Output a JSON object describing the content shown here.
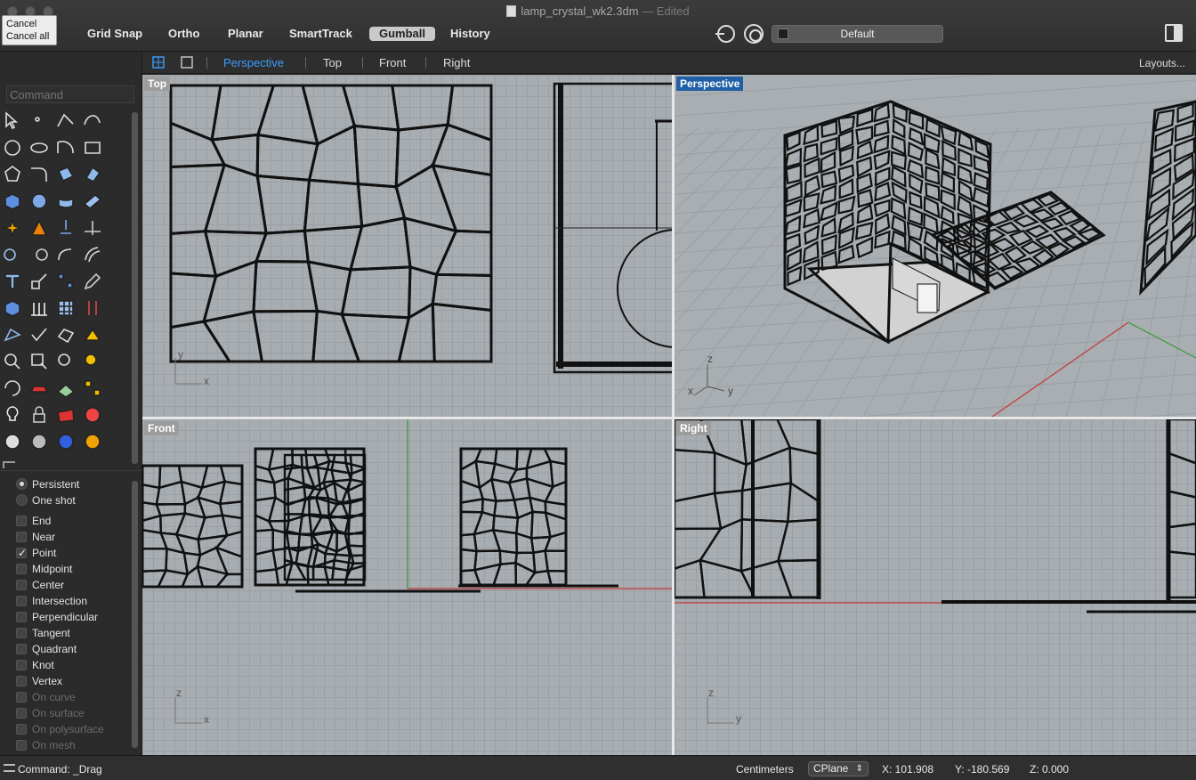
{
  "window": {
    "filename": "lamp_crystal_wk2.3dm",
    "status": "— Edited"
  },
  "cancel": {
    "cancel": "Cancel",
    "cancel_all": "Cancel all"
  },
  "toolbar": {
    "grid_snap": "Grid Snap",
    "ortho": "Ortho",
    "planar": "Planar",
    "smarttrack": "SmartTrack",
    "gumball": "Gumball",
    "history": "History",
    "layer": "Default"
  },
  "tabs": {
    "perspective": "Perspective",
    "top": "Top",
    "front": "Front",
    "right": "Right",
    "layouts": "Layouts..."
  },
  "command": {
    "placeholder": "Command"
  },
  "osnap": {
    "persistent": "Persistent",
    "one_shot": "One shot",
    "end": "End",
    "near": "Near",
    "point": "Point",
    "midpoint": "Midpoint",
    "center": "Center",
    "intersection": "Intersection",
    "perpendicular": "Perpendicular",
    "tangent": "Tangent",
    "quadrant": "Quadrant",
    "knot": "Knot",
    "vertex": "Vertex",
    "on_curve": "On curve",
    "on_surface": "On surface",
    "on_polysurface": "On polysurface",
    "on_mesh": "On mesh"
  },
  "viewports": {
    "top": "Top",
    "perspective": "Perspective",
    "front": "Front",
    "right": "Right"
  },
  "axes": {
    "x": "x",
    "y": "y",
    "z": "z"
  },
  "status": {
    "command": "Command: _Drag",
    "units": "Centimeters",
    "cplane": "CPlane",
    "x": "X: 101.908",
    "y": "Y: -180.569",
    "z": "Z: 0.000"
  }
}
